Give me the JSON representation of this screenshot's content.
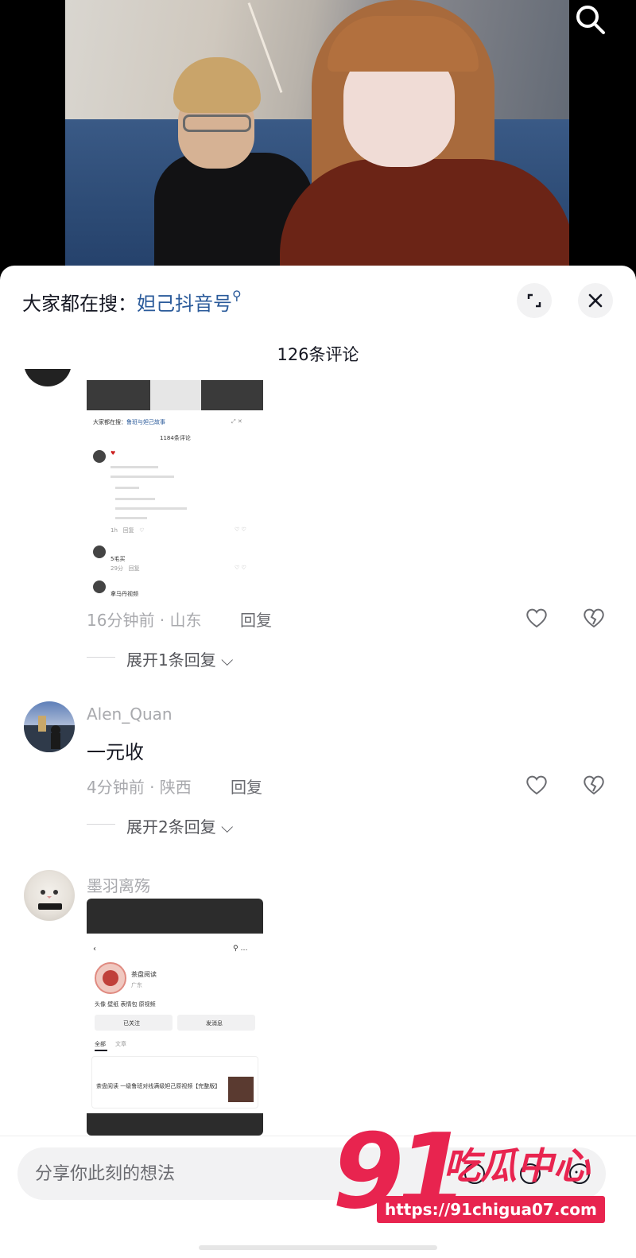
{
  "sheet": {
    "search_prefix": "大家都在搜：",
    "search_keyword": "妲己抖音号",
    "comment_count": "126条评论"
  },
  "comments": [
    {
      "time_location": "16分钟前 · 山东",
      "reply_label": "回复",
      "expand_label": "展开1条回复",
      "image": {
        "hint_prefix": "大家都在搜：",
        "hint_keyword": "鲁班与妲己故事",
        "count": "1184条评论",
        "item_text_1": "5毛买",
        "item_meta": "回复",
        "item_text_2": "拿马丹视频"
      }
    },
    {
      "username": "Alen_Quan",
      "text": "一元收",
      "time_location": "4分钟前 · 陕西",
      "reply_label": "回复",
      "expand_label": "展开2条回复"
    },
    {
      "username": "墨羽离殇",
      "image": {
        "account_name": "茶盘阅读",
        "location": "广东",
        "tags": "头像 壁纸 表情包 原视频",
        "follow_label": "已关注",
        "message_label": "发消息",
        "tab_all": "全部",
        "tab_text": "文章",
        "post_text": "茶盘阅读 一级鲁班对线满级妲己原视频【完整版】"
      }
    }
  ],
  "input": {
    "placeholder": "分享你此刻的想法"
  },
  "watermark": {
    "number": "91",
    "name": "吃瓜中心",
    "url": "https://91chigua07.com"
  }
}
